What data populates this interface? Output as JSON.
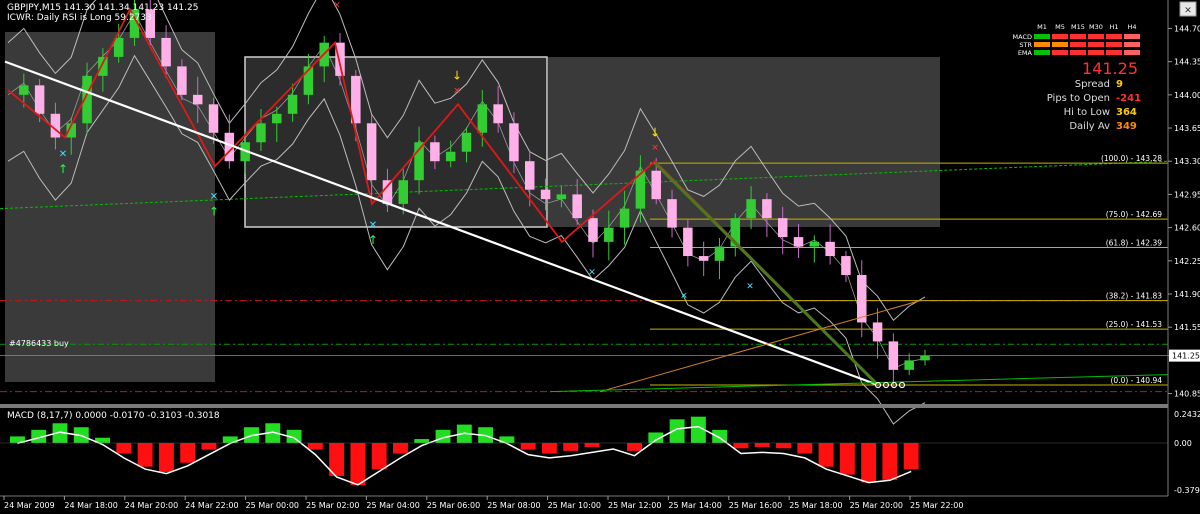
{
  "header": {
    "symbol_line": "GBPJPY,M15  141.30 141.34 141.23 141.25",
    "indicator_line": "ICWR: Daily RSI is Long 59.2733"
  },
  "panel": {
    "timeframes": [
      "M1",
      "M5",
      "M15",
      "M30",
      "H1",
      "H4"
    ],
    "rows": [
      {
        "label": "MACD",
        "colors": [
          "#00c000",
          "#ff3030",
          "#ff3030",
          "#ff3030",
          "#ff3030",
          "#ff6060"
        ]
      },
      {
        "label": "STR",
        "colors": [
          "#ff8c00",
          "#ff8c00",
          "#ff3030",
          "#ff3030",
          "#ff3030",
          "#ff6060"
        ]
      },
      {
        "label": "EMA",
        "colors": [
          "#00c000",
          "#ff3030",
          "#ff3030",
          "#ff3030",
          "#ff3030",
          "#ff6060"
        ]
      }
    ],
    "price": "141.25",
    "stats": [
      {
        "label": "Spread",
        "value": "9",
        "color": "#ffcc00"
      },
      {
        "label": "Pips to Open",
        "value": "-241",
        "color": "#ff3030"
      },
      {
        "label": "Hi to Low",
        "value": "364",
        "color": "#ffcc00"
      },
      {
        "label": "Daily Av",
        "value": "349",
        "color": "#ff8c00"
      }
    ]
  },
  "order_label": "#4786433 buy",
  "current_price_label": "141.25",
  "fib_labels": [
    {
      "text": "(100.0) - 143.28",
      "price": 143.28
    },
    {
      "text": "(75.0) - 142.69",
      "price": 142.69
    },
    {
      "text": "(61.8) - 142.39",
      "price": 142.39
    },
    {
      "text": "(38.2) - 141.83",
      "price": 141.83
    },
    {
      "text": "(25.0) - 141.53",
      "price": 141.53
    },
    {
      "text": "(0.0) - 140.94",
      "price": 140.94
    }
  ],
  "macd": {
    "label": "MACD  (8,17,7) 0.0000 -0.0170 -0.3103 -0.3018",
    "y_ticks": [
      "0.2432",
      "0.00",
      "-0.3796"
    ]
  },
  "chart_data": {
    "type": "candlestick",
    "title": "GBPJPY,M15",
    "y_ticks": [
      144.7,
      144.35,
      144.0,
      143.65,
      143.3,
      142.95,
      142.6,
      142.25,
      141.9,
      141.55,
      141.25,
      140.85
    ],
    "ylim": [
      140.74,
      145.0
    ],
    "x_tick_labels": [
      "24 Mar 2009",
      "24 Mar 18:00",
      "24 Mar 20:00",
      "24 Mar 22:00",
      "25 Mar 00:00",
      "25 Mar 02:00",
      "25 Mar 04:00",
      "25 Mar 06:00",
      "25 Mar 08:00",
      "25 Mar 10:00",
      "25 Mar 12:00",
      "25 Mar 14:00",
      "25 Mar 16:00",
      "25 Mar 18:00",
      "25 Mar 20:00",
      "25 Mar 22:00"
    ],
    "zigzag": [
      144.05,
      143.55,
      144.9,
      143.25,
      144.55,
      142.85,
      143.9,
      142.45,
      143.3,
      140.94
    ],
    "close_path": [
      144.0,
      144.1,
      143.8,
      143.55,
      143.7,
      144.2,
      144.4,
      144.6,
      144.9,
      144.6,
      144.3,
      144.0,
      143.9,
      143.6,
      143.3,
      143.5,
      143.7,
      143.8,
      144.0,
      144.3,
      144.55,
      144.2,
      143.7,
      143.1,
      142.85,
      143.1,
      143.5,
      143.3,
      143.4,
      143.6,
      143.9,
      143.7,
      143.3,
      143.0,
      142.9,
      142.95,
      142.7,
      142.45,
      142.6,
      142.8,
      143.2,
      142.9,
      142.6,
      142.3,
      142.25,
      142.4,
      142.7,
      142.9,
      142.7,
      142.5,
      142.4,
      142.45,
      142.3,
      142.1,
      141.6,
      141.4,
      141.1,
      141.2,
      141.25
    ],
    "current_price": 141.25,
    "series": [
      {
        "name": "MACD",
        "values": [
          0.05,
          0.1,
          0.15,
          0.12,
          0.04,
          -0.08,
          -0.18,
          -0.22,
          -0.15,
          -0.05,
          0.05,
          0.12,
          0.15,
          0.1,
          -0.05,
          -0.25,
          -0.32,
          -0.2,
          -0.08,
          0.03,
          0.1,
          0.14,
          0.12,
          0.05,
          -0.05,
          -0.08,
          -0.06,
          -0.03,
          0.0,
          -0.06,
          0.08,
          0.18,
          0.2,
          0.1,
          -0.04,
          -0.03,
          -0.04,
          -0.08,
          -0.18,
          -0.24,
          -0.3,
          -0.28,
          -0.2
        ]
      }
    ]
  }
}
